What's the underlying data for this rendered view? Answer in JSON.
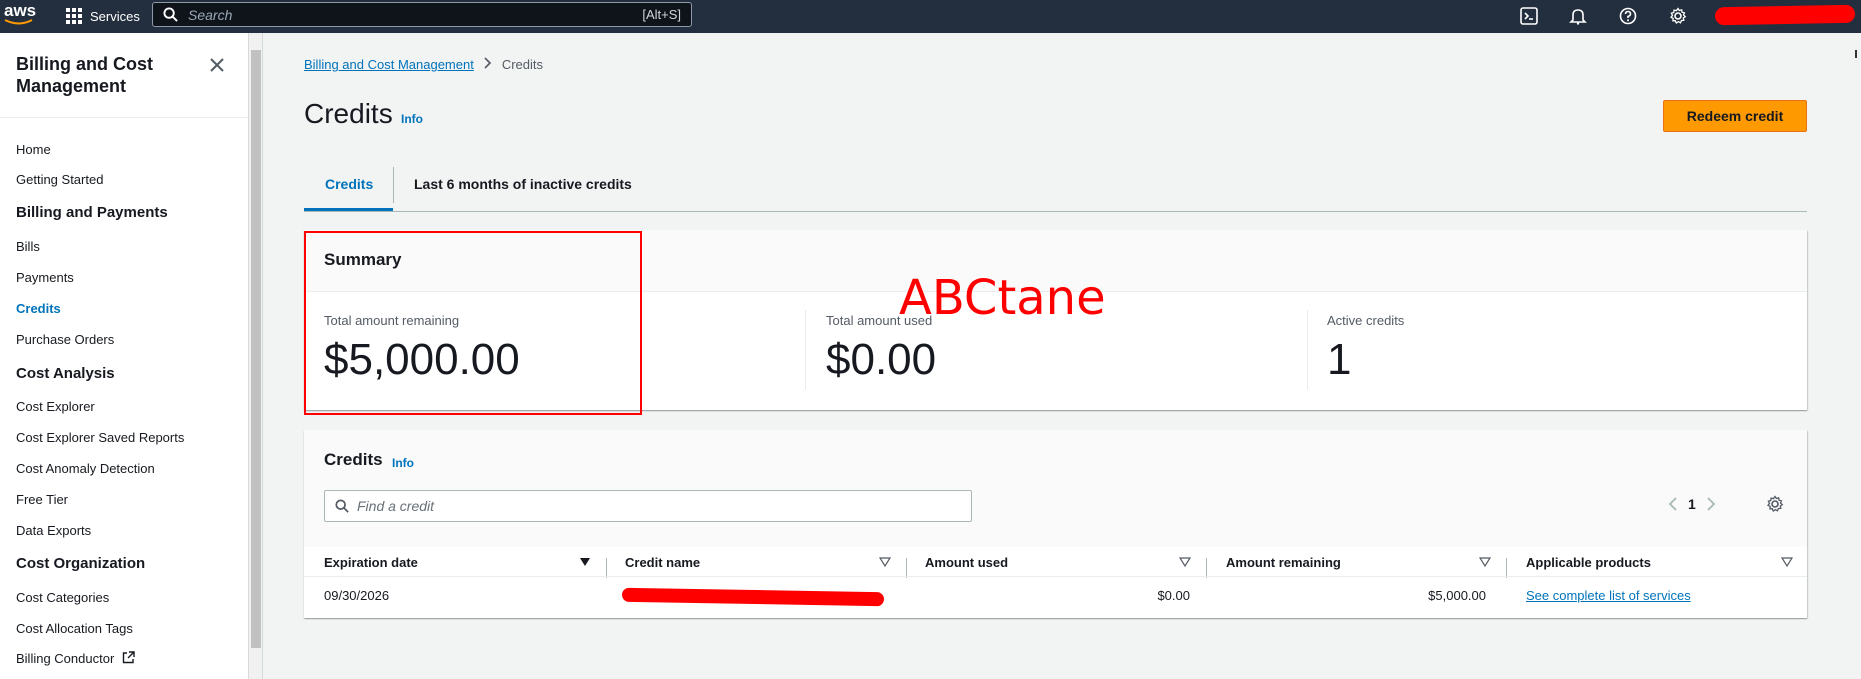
{
  "topnav": {
    "logo_text": "aws",
    "services_label": "Services",
    "search_placeholder": "Search",
    "search_shortcut": "[Alt+S]",
    "icons": [
      "cloudshell-icon",
      "bell-icon",
      "help-icon",
      "gear-icon"
    ],
    "account_redacted": true
  },
  "sidebar": {
    "title": "Billing and Cost Management",
    "items": [
      {
        "label": "Home",
        "type": "item"
      },
      {
        "label": "Getting Started",
        "type": "item"
      },
      {
        "label": "Billing and Payments",
        "type": "section"
      },
      {
        "label": "Bills",
        "type": "item"
      },
      {
        "label": "Payments",
        "type": "item"
      },
      {
        "label": "Credits",
        "type": "item",
        "active": true
      },
      {
        "label": "Purchase Orders",
        "type": "item"
      },
      {
        "label": "Cost Analysis",
        "type": "section"
      },
      {
        "label": "Cost Explorer",
        "type": "item"
      },
      {
        "label": "Cost Explorer Saved Reports",
        "type": "item"
      },
      {
        "label": "Cost Anomaly Detection",
        "type": "item"
      },
      {
        "label": "Free Tier",
        "type": "item"
      },
      {
        "label": "Data Exports",
        "type": "item"
      },
      {
        "label": "Cost Organization",
        "type": "section"
      },
      {
        "label": "Cost Categories",
        "type": "item"
      },
      {
        "label": "Cost Allocation Tags",
        "type": "item"
      },
      {
        "label": "Billing Conductor",
        "type": "item",
        "external": true
      }
    ]
  },
  "breadcrumb": {
    "parent": "Billing and Cost Management",
    "current": "Credits"
  },
  "page": {
    "title": "Credits",
    "info_label": "Info",
    "redeem_button": "Redeem credit"
  },
  "tabs": [
    {
      "label": "Credits",
      "active": true
    },
    {
      "label": "Last 6 months of inactive credits",
      "active": false
    }
  ],
  "summary": {
    "title": "Summary",
    "metrics": [
      {
        "label": "Total amount remaining",
        "value": "$5,000.00"
      },
      {
        "label": "Total amount used",
        "value": "$0.00"
      },
      {
        "label": "Active credits",
        "value": "1"
      }
    ],
    "annotation": "ABCtane"
  },
  "credits_table": {
    "title": "Credits",
    "info_label": "Info",
    "search_placeholder": "Find a credit",
    "page_number": "1",
    "columns": [
      "Expiration date",
      "Credit name",
      "Amount used",
      "Amount remaining",
      "Applicable products"
    ],
    "rows": [
      {
        "expiration_date": "09/30/2026",
        "credit_name_redacted": true,
        "amount_used": "$0.00",
        "amount_remaining": "$5,000.00",
        "applicable_products": "See complete list of services"
      }
    ]
  },
  "colors": {
    "nav_bg": "#232f3e",
    "link": "#0073bb",
    "primary_button": "#ff9900",
    "annotation_red": "#ff0000"
  }
}
